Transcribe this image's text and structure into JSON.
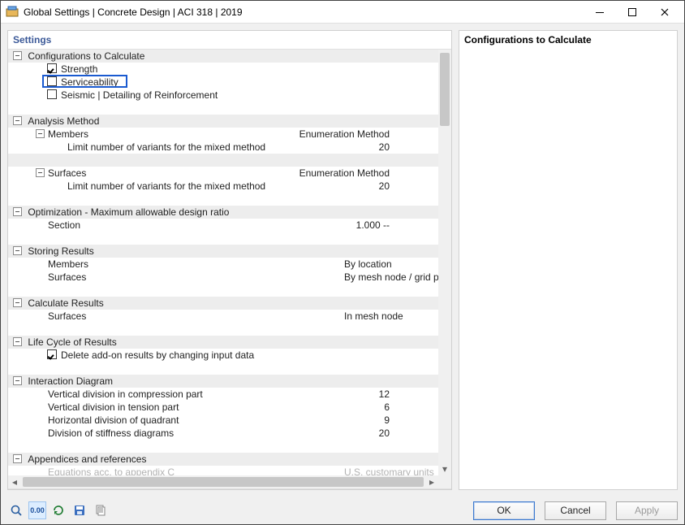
{
  "window": {
    "title": "Global Settings | Concrete Design | ACI 318 | 2019"
  },
  "leftPanel": {
    "header": "Settings"
  },
  "rightPanel": {
    "header": "Configurations to Calculate"
  },
  "tree": {
    "configs": {
      "title": "Configurations to Calculate",
      "strength": "Strength",
      "serviceability": "Serviceability",
      "seismic": "Seismic | Detailing of Reinforcement"
    },
    "analysis": {
      "title": "Analysis Method",
      "members": "Members",
      "membersVal": "Enumeration Method",
      "membersLimit": "Limit number of variants for the mixed method",
      "membersLimitVal": "20",
      "surfaces": "Surfaces",
      "surfacesVal": "Enumeration Method",
      "surfacesLimit": "Limit number of variants for the mixed method",
      "surfacesLimitVal": "20"
    },
    "optim": {
      "title": "Optimization - Maximum allowable design ratio",
      "section": "Section",
      "sectionVal": "1.000 --"
    },
    "storing": {
      "title": "Storing Results",
      "members": "Members",
      "membersVal": "By location",
      "surfaces": "Surfaces",
      "surfacesVal": "By mesh node / grid point"
    },
    "calc": {
      "title": "Calculate Results",
      "surfaces": "Surfaces",
      "surfacesVal": "In mesh node"
    },
    "life": {
      "title": "Life Cycle of Results",
      "delete": "Delete add-on results by changing input data"
    },
    "inter": {
      "title": "Interaction Diagram",
      "vComp": "Vertical division in compression part",
      "vCompVal": "12",
      "vTen": "Vertical division in tension part",
      "vTenVal": "6",
      "hQuad": "Horizontal division of quadrant",
      "hQuadVal": "9",
      "stiff": "Division of stiffness diagrams",
      "stiffVal": "20"
    },
    "appendix": {
      "title": "Appendices and references",
      "eq": "Equations acc. to appendix C",
      "eqVal": "U.S. customary units"
    }
  },
  "buttons": {
    "ok": "OK",
    "cancel": "Cancel",
    "apply": "Apply"
  },
  "toolbarIcons": {
    "search": "search-icon",
    "decimals": "decimals-icon",
    "refresh": "refresh-icon",
    "save": "save-icon",
    "copy": "copy-icon"
  },
  "decimalsGlyph": "0.00"
}
